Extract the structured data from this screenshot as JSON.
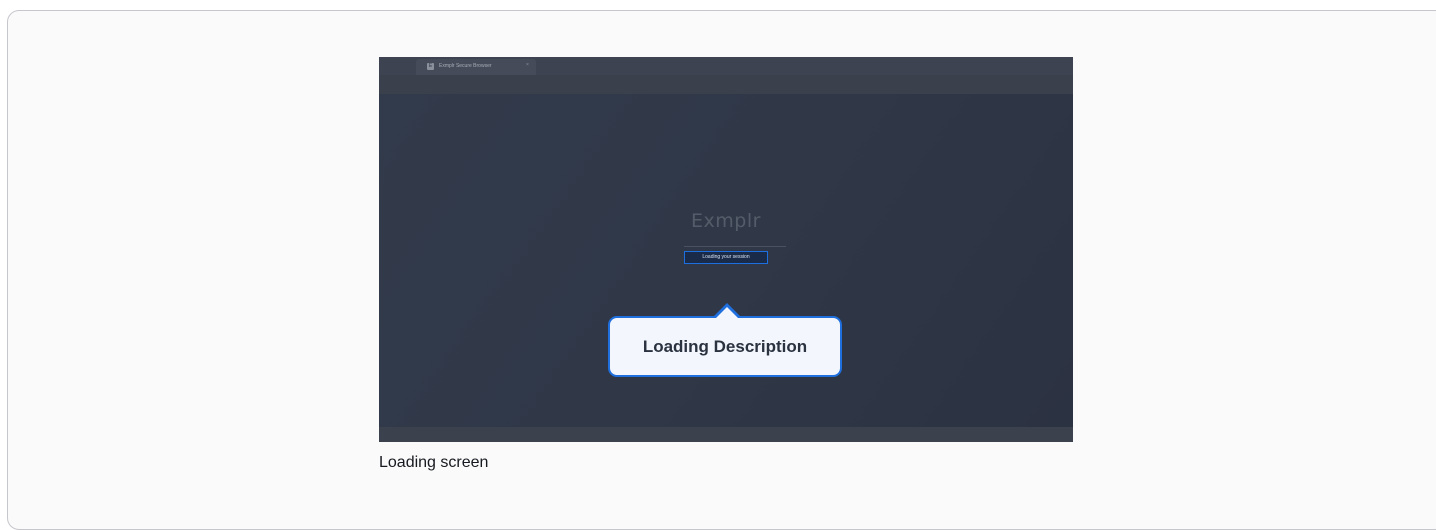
{
  "browser": {
    "tab_title": "Exmplr Secure Browser",
    "tab_close": "×",
    "tab_favicon": "E"
  },
  "loading_screen": {
    "brand_name": "Exmplr",
    "status_text": "Loading your session"
  },
  "callout": {
    "label": "Loading Description"
  },
  "caption": "Loading screen",
  "colors": {
    "accent": "#1f6fde",
    "screen_bg": "#2e3645"
  }
}
